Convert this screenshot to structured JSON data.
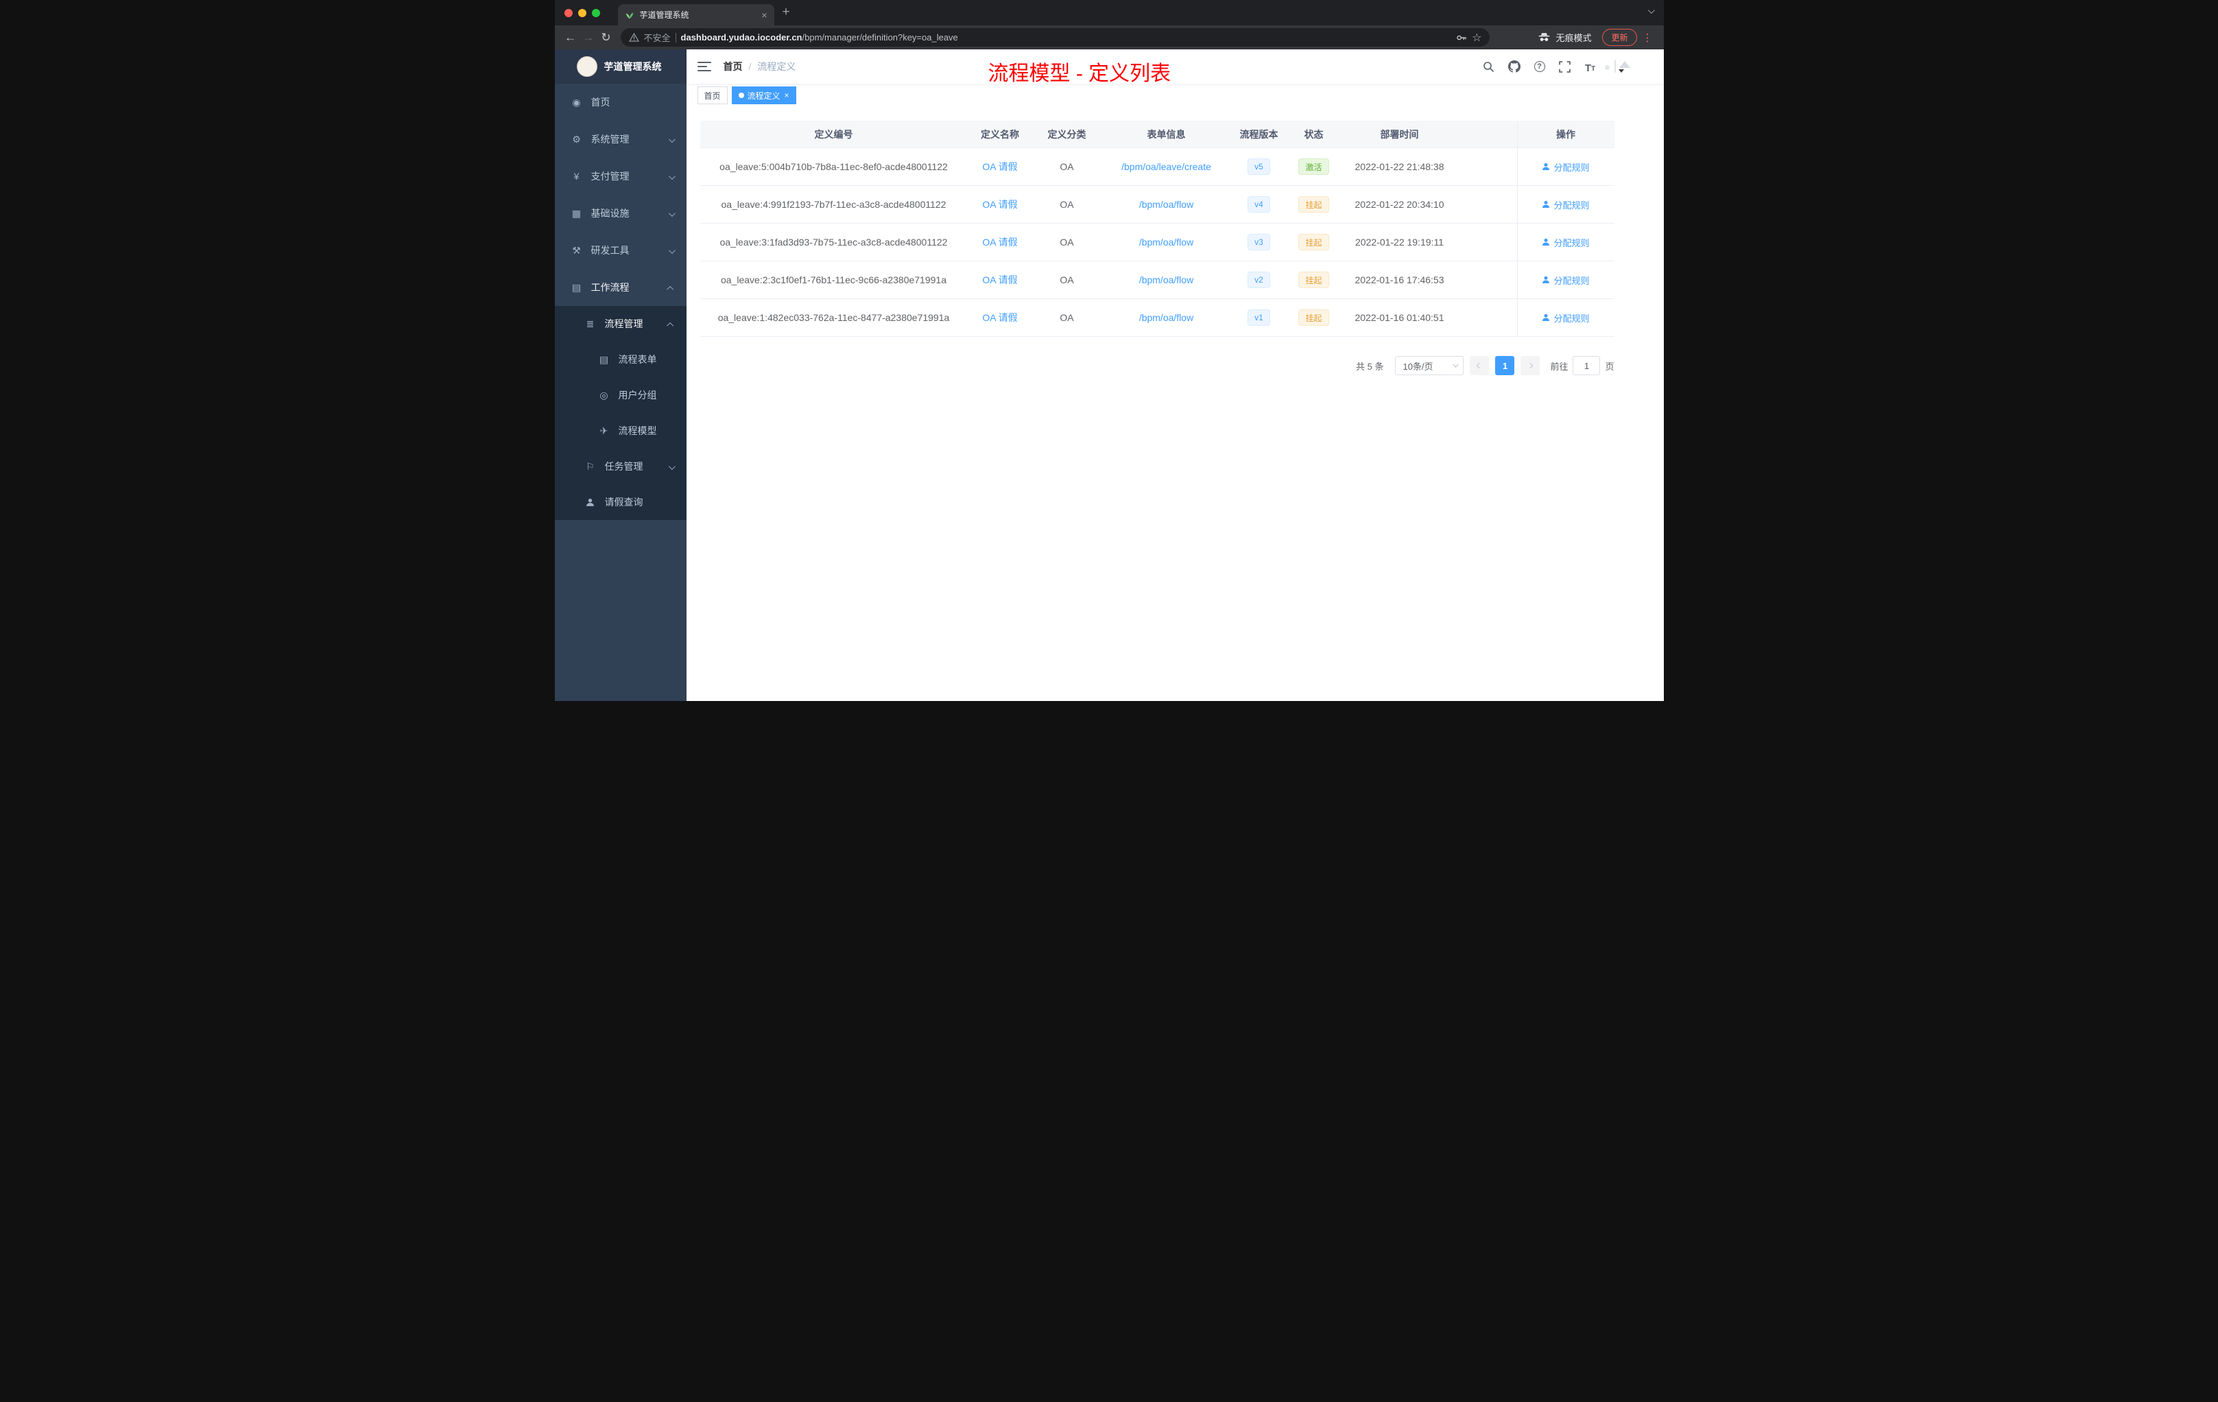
{
  "colors": {
    "accent": "#409eff",
    "success": "#67c23a",
    "warning": "#e6a23c",
    "annotation": "#fe0000",
    "sidebar_bg": "#304156",
    "submenu_bg": "#1f2d3d"
  },
  "browser": {
    "tab_title": "芋道管理系统",
    "close_glyph": "×",
    "newtab_glyph": "+",
    "back_glyph": "←",
    "forward_glyph": "→",
    "reload_glyph": "↻",
    "security_label": "不安全",
    "url_domain": "dashboard.yudao.iocoder.cn",
    "url_path": "/bpm/manager/definition?key=oa_leave",
    "star_glyph": "☆",
    "incognito_label": "无痕模式",
    "update_label": "更新",
    "menu_dots": "⋮"
  },
  "sidebar": {
    "logo_title": "芋道管理系统",
    "items": [
      {
        "label": "首页",
        "icon": "dashboard-icon",
        "glyph": "◉"
      },
      {
        "label": "系统管理",
        "icon": "gear-icon",
        "glyph": "⚙"
      },
      {
        "label": "支付管理",
        "icon": "yen-icon",
        "glyph": "¥"
      },
      {
        "label": "基础设施",
        "icon": "infrastructure-icon",
        "glyph": "▦"
      },
      {
        "label": "研发工具",
        "icon": "devtools-icon",
        "glyph": "⚒"
      },
      {
        "label": "工作流程",
        "icon": "workflow-icon",
        "glyph": "▤"
      },
      {
        "label": "流程管理",
        "icon": "process-management-icon",
        "glyph": "≣"
      },
      {
        "label": "流程表单",
        "icon": "form-icon",
        "glyph": "▤"
      },
      {
        "label": "用户分组",
        "icon": "user-group-icon",
        "glyph": "◎"
      },
      {
        "label": "流程模型",
        "icon": "paper-plane-icon",
        "glyph": "✈"
      },
      {
        "label": "任务管理",
        "icon": "flag-icon",
        "glyph": "⚐"
      },
      {
        "label": "请假查询",
        "icon": "user-icon",
        "glyph": ""
      }
    ]
  },
  "header": {
    "breadcrumb_home": "首页",
    "breadcrumb_separator": "/",
    "breadcrumb_current": "流程定义",
    "annotation": "流程模型 - 定义列表",
    "help_glyph": "?",
    "fontsize_glyph_big": "T",
    "fontsize_glyph_small": "T"
  },
  "tags": {
    "home": "首页",
    "active": "流程定义",
    "close_glyph": "×"
  },
  "table": {
    "columns": {
      "id": "定义编号",
      "name": "定义名称",
      "category": "定义分类",
      "form": "表单信息",
      "version": "流程版本",
      "status": "状态",
      "deploy_time": "部署时间",
      "action": "操作"
    },
    "rows": [
      {
        "id": "oa_leave:5:004b710b-7b8a-11ec-8ef0-acde48001122",
        "name": "OA 请假",
        "category": "OA",
        "form": "/bpm/oa/leave/create",
        "version": "v5",
        "status": "激活",
        "status_type": "success",
        "deploy_time": "2022-01-22 21:48:38",
        "action": "分配规则"
      },
      {
        "id": "oa_leave:4:991f2193-7b7f-11ec-a3c8-acde48001122",
        "name": "OA 请假",
        "category": "OA",
        "form": "/bpm/oa/flow",
        "version": "v4",
        "status": "挂起",
        "status_type": "warning",
        "deploy_time": "2022-01-22 20:34:10",
        "action": "分配规则"
      },
      {
        "id": "oa_leave:3:1fad3d93-7b75-11ec-a3c8-acde48001122",
        "name": "OA 请假",
        "category": "OA",
        "form": "/bpm/oa/flow",
        "version": "v3",
        "status": "挂起",
        "status_type": "warning",
        "deploy_time": "2022-01-22 19:19:11",
        "action": "分配规则"
      },
      {
        "id": "oa_leave:2:3c1f0ef1-76b1-11ec-9c66-a2380e71991a",
        "name": "OA 请假",
        "category": "OA",
        "form": "/bpm/oa/flow",
        "version": "v2",
        "status": "挂起",
        "status_type": "warning",
        "deploy_time": "2022-01-16 17:46:53",
        "action": "分配规则"
      },
      {
        "id": "oa_leave:1:482ec033-762a-11ec-8477-a2380e71991a",
        "name": "OA 请假",
        "category": "OA",
        "form": "/bpm/oa/flow",
        "version": "v1",
        "status": "挂起",
        "status_type": "warning",
        "deploy_time": "2022-01-16 01:40:51",
        "action": "分配规则"
      }
    ]
  },
  "pagination": {
    "total": "共 5 条",
    "page_size": "10条/页",
    "current_page": "1",
    "goto_label": "前往",
    "goto_value": "1",
    "page_unit": "页"
  }
}
